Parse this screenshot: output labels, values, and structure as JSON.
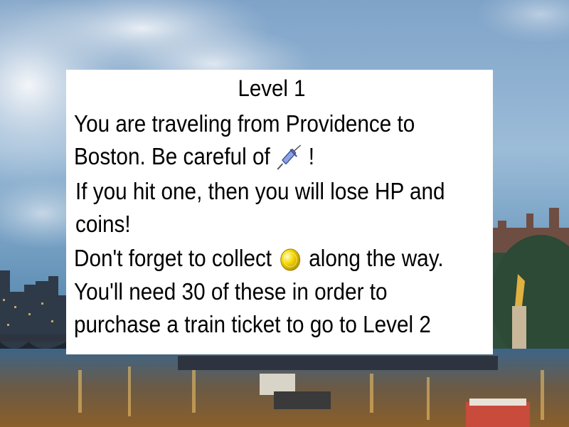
{
  "level_title": "Level 1",
  "instructions": {
    "line1": "You are traveling from Providence to",
    "line2_before": "Boston. Be careful of",
    "line2_after": "!",
    "line3": "If you hit one, then you will lose HP and",
    "line4": "coins!",
    "line5_before": "Don't forget to collect",
    "line5_after": "along the way.",
    "line6": "You'll need 30 of these in order to",
    "line7": "purchase a train ticket to go to Level 2"
  },
  "icons": {
    "hazard": "syringe-icon",
    "collectible": "coin-icon"
  },
  "colors": {
    "dialog_background": "#ffffff",
    "coin": "#f5d800",
    "syringe": "#8aa2e8"
  }
}
